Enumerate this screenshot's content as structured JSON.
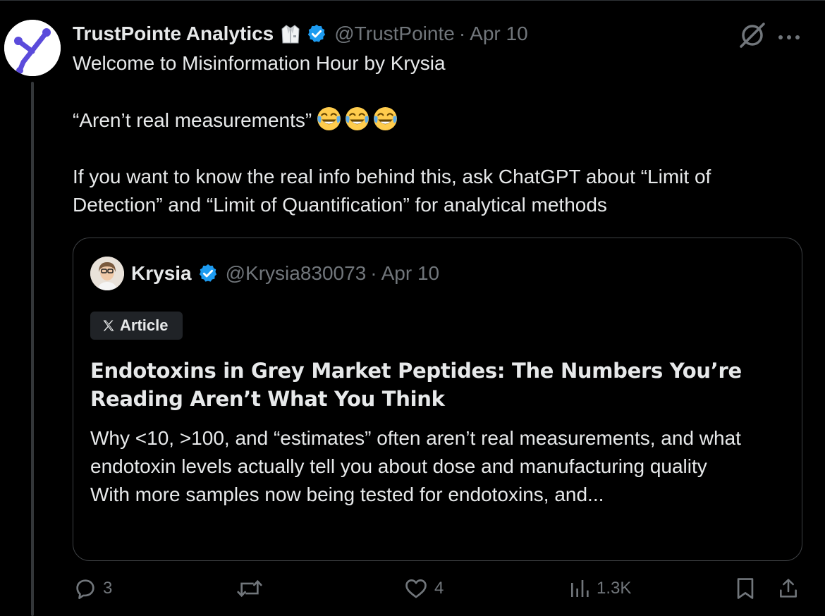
{
  "tweet": {
    "display_name": "TrustPointe Analytics",
    "handle": "@TrustPointe",
    "separator": "·",
    "date": "Apr 10",
    "text_line1": "Welcome to Misinformation Hour by Krysia",
    "text_line2": "“Aren’t real measurements”",
    "text_line3": "If you want to know the real info behind this, ask ChatGPT about “Limit of Detection” and “Limit of Quantification” for analytical methods"
  },
  "quote": {
    "display_name": "Krysia",
    "handle": "@Krysia830073",
    "separator": "·",
    "date": "Apr 10",
    "badge_label": "Article",
    "title": "Endotoxins in Grey Market Peptides: The Numbers You’re Reading Aren’t What You Think",
    "body_line1": "Why <10, >100, and “estimates” often aren’t real measurements, and what endotoxin levels actually tell you about dose and manufacturing quality",
    "body_line2": "With more samples now being tested for endotoxins, and..."
  },
  "actions": {
    "replies": "3",
    "reposts": "",
    "likes": "4",
    "views": "1.3K"
  },
  "colors": {
    "background": "#000000",
    "text": "#e7e9ea",
    "muted": "#71767b",
    "verified": "#1d9bf0",
    "border": "#3e4144",
    "brand_purple": "#5b4bdb"
  },
  "icons": [
    "lab-coat-icon",
    "verified-badge-icon",
    "grok-icon",
    "more-icon",
    "laughing-emoji-icon",
    "x-logo-icon",
    "reply-icon",
    "repost-icon",
    "like-icon",
    "views-icon",
    "bookmark-icon",
    "share-icon"
  ]
}
